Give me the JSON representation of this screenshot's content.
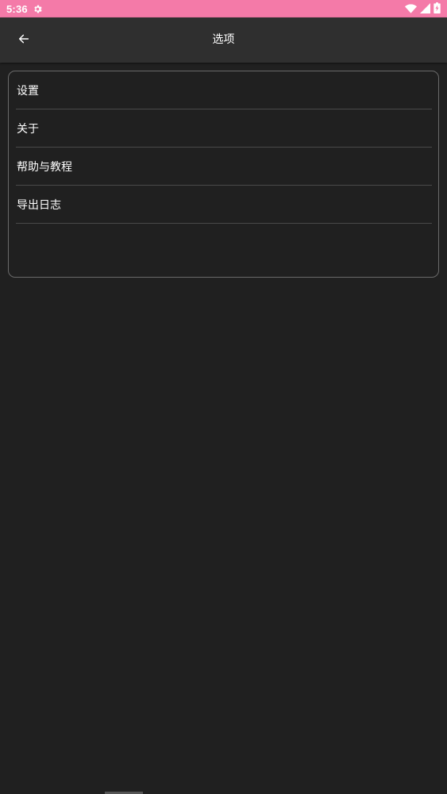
{
  "status_bar": {
    "time": "5:36",
    "icons": [
      "settings-gear-icon",
      "wifi-icon",
      "cell-signal-icon",
      "battery-icon"
    ],
    "background_color": "#f47aa8"
  },
  "app_bar": {
    "back_icon": "arrow-left-icon",
    "title": "选项"
  },
  "options": {
    "items": [
      {
        "label": "设置"
      },
      {
        "label": "关于"
      },
      {
        "label": "帮助与教程"
      },
      {
        "label": "导出日志"
      }
    ]
  },
  "colors": {
    "background": "#202020",
    "app_bar": "#2f2f2f",
    "card_border": "#6a6a6a",
    "divider": "#4a4a4a",
    "text": "#ffffff"
  }
}
